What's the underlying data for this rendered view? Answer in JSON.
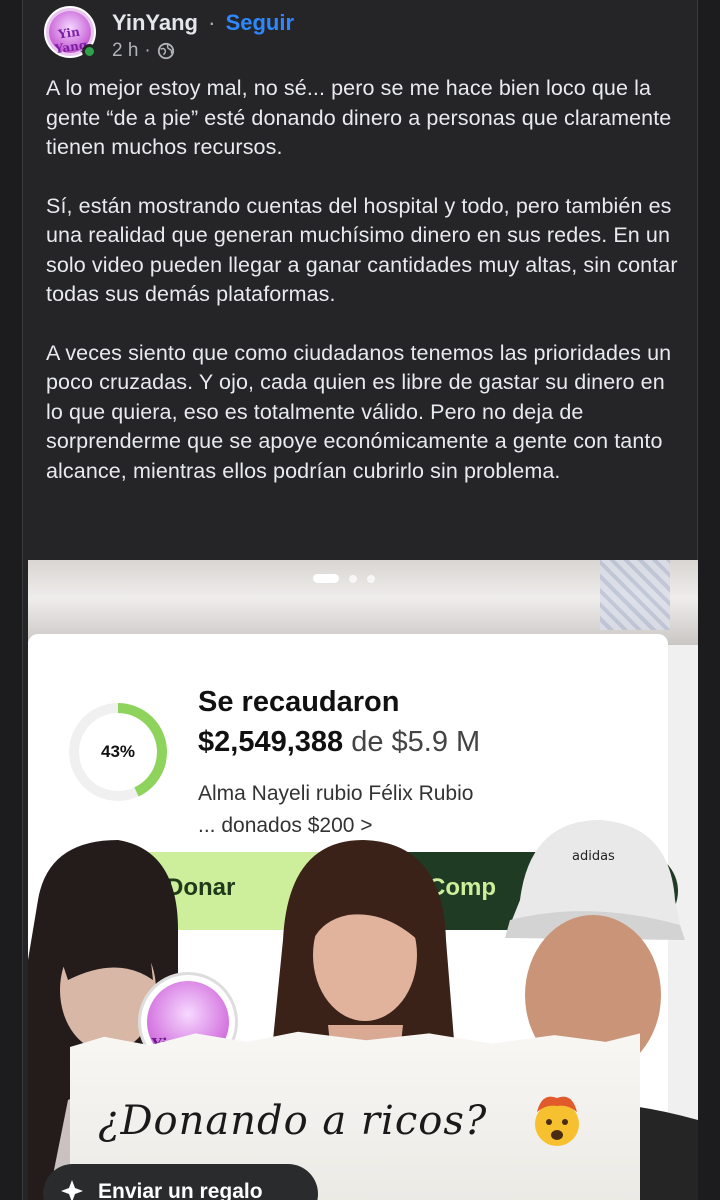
{
  "post": {
    "author": "YinYang",
    "separator": "·",
    "follow_label": "Seguir",
    "time": "2 h",
    "avatar_text": "Yin Yang",
    "paragraphs": [
      "A lo mejor estoy mal, no sé... pero se me hace bien loco que la gente “de a pie” esté donando dinero a personas que claramente tienen muchos recursos.",
      "Sí, están mostrando cuentas del hospital y todo, pero también es una realidad que generan muchísimo dinero en sus redes. En un solo video pueden llegar a ganar cantidades muy altas, sin contar todas sus demás plataformas.",
      "A veces siento que como ciudadanos tenemos las prioridades un poco cruzadas. Y ojo, cada quien es libre de gastar su dinero en lo que quiera, eso es totalmente válido. Pero no deja de sorprenderme que se apoye económicamente a gente con tanto alcance, mientras ellos podrían cubrirlo sin problema."
    ]
  },
  "media": {
    "carousel_pages": 3,
    "carousel_active": 1,
    "fund": {
      "percent_label": "43%",
      "percent_value": 0.43,
      "title": "Se recaudaron",
      "amount": "$2,549,388",
      "goal_text": " de $5.9 M",
      "donor_line1": "Alma Nayeli rubio Félix Rubio",
      "donor_line2": "... donados $200 >",
      "donate_label": "Donar",
      "share_label": "Comp"
    },
    "sticker_text": "Yin Yang",
    "headline": "¿Donando a ricos?",
    "gift_label": "Enviar un regalo"
  },
  "colors": {
    "background": "#252527",
    "follow": "#2d88ff",
    "online": "#31a24c",
    "progress": "#8ed35c",
    "donate_btn": "#cdee9a",
    "share_btn": "#1f3b23"
  }
}
